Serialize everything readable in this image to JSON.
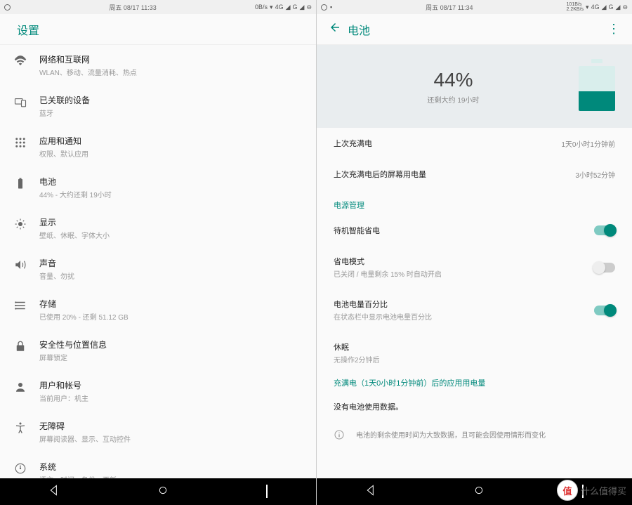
{
  "left": {
    "status": {
      "date": "周五 08/17",
      "time": "11:33",
      "speed": "0B/s",
      "network": "4G",
      "signal": "G"
    },
    "title": "设置",
    "items": [
      {
        "name": "network",
        "title": "网络和互联网",
        "sub": "WLAN、移动、流量消耗、热点"
      },
      {
        "name": "devices",
        "title": "已关联的设备",
        "sub": "蓝牙"
      },
      {
        "name": "apps",
        "title": "应用和通知",
        "sub": "权限、默认应用"
      },
      {
        "name": "battery",
        "title": "电池",
        "sub": "44% - 大约还剩 19小时"
      },
      {
        "name": "display",
        "title": "显示",
        "sub": "壁纸、休眠、字体大小"
      },
      {
        "name": "sound",
        "title": "声音",
        "sub": "音量、勿扰"
      },
      {
        "name": "storage",
        "title": "存储",
        "sub": "已使用 20% - 还剩 51.12 GB"
      },
      {
        "name": "security",
        "title": "安全性与位置信息",
        "sub": "屏幕锁定"
      },
      {
        "name": "users",
        "title": "用户和帐号",
        "sub": "当前用户：机主"
      },
      {
        "name": "accessibility",
        "title": "无障碍",
        "sub": "屏幕阅读器、显示、互动控件"
      },
      {
        "name": "system",
        "title": "系统",
        "sub": "语言、时间、备份、更新"
      }
    ]
  },
  "right": {
    "status": {
      "date": "周五 08/17",
      "time": "11:34",
      "speed_up": "101B/s",
      "speed_down": "2.2KB/s",
      "network": "4G",
      "signal": "G"
    },
    "title": "电池",
    "hero": {
      "percent": "44%",
      "remaining": "还剩大约 19小时",
      "fill_pct": 44
    },
    "rows": [
      {
        "label": "上次充满电",
        "value": "1天0小时1分钟前"
      },
      {
        "label": "上次充满电后的屏幕用电量",
        "value": "3小时52分钟"
      }
    ],
    "section_power": "电源管理",
    "power": [
      {
        "name": "standby-save",
        "label": "待机智能省电",
        "sub": "",
        "toggle": "on"
      },
      {
        "name": "save-mode",
        "label": "省电模式",
        "sub": "已关闭 / 电量剩余 15% 时自动开启",
        "toggle": "off"
      },
      {
        "name": "battery-percent",
        "label": "电池电量百分比",
        "sub": "在状态栏中显示电池电量百分比",
        "toggle": "on"
      },
      {
        "name": "sleep",
        "label": "休眠",
        "sub": "无操作2分钟后",
        "toggle": ""
      }
    ],
    "usage_title": "充满电（1天0小时1分钟前）后的应用用电量",
    "no_data": "没有电池使用数据。",
    "info": "电池的剩余使用时间为大致数据，且可能会因使用情形而变化"
  },
  "watermark": {
    "badge": "值",
    "text": "什么值得买"
  }
}
